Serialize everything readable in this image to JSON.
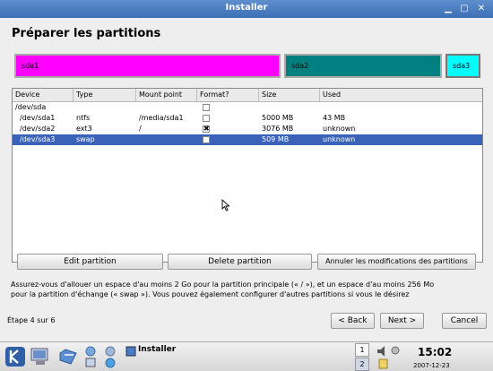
{
  "window": {
    "title": "Installer"
  },
  "page": {
    "heading": "Préparer les partitions"
  },
  "partitions_bar": [
    {
      "label": "sda1",
      "color": "#ff00ff"
    },
    {
      "label": "sda2",
      "color": "#008080"
    },
    {
      "label": "sda3",
      "color": "#00ffff"
    }
  ],
  "table": {
    "headers": [
      "Device",
      "Type",
      "Mount point",
      "Format?",
      "Size",
      "Used"
    ],
    "rows": [
      {
        "device": "/dev/sda",
        "type": "",
        "mount": "",
        "format": false,
        "size": "",
        "used": ""
      },
      {
        "device": "/dev/sda1",
        "type": "ntfs",
        "mount": "/media/sda1",
        "format": false,
        "size": "5000 MB",
        "used": "43 MB"
      },
      {
        "device": "/dev/sda2",
        "type": "ext3",
        "mount": "/",
        "format": true,
        "size": "3076 MB",
        "used": "unknown"
      },
      {
        "device": "/dev/sda3",
        "type": "swap",
        "mount": "",
        "format": false,
        "size": "509 MB",
        "used": "unknown",
        "selected": true
      }
    ]
  },
  "actions": {
    "edit": "Edit partition",
    "delete": "Delete partition",
    "undo": "Annuler les modifications des partitions"
  },
  "info_text": {
    "line1": "Assurez-vous d'allouer un espace d'au moins 2 Go pour la partition principale (« / »), et un espace d'au moins 256 Mo",
    "line2": "pour la partition d'échange (« swap »). Vous pouvez également configurer d'autres partitions si vous le désirez"
  },
  "footer": {
    "step": "Étape 4 sur 6",
    "back": "< Back",
    "next": "Next >",
    "cancel": "Cancel"
  },
  "taskbar": {
    "task_label": "Installer",
    "desktops": [
      "1",
      "2"
    ],
    "time": "15:02",
    "date": "2007-12-23"
  }
}
